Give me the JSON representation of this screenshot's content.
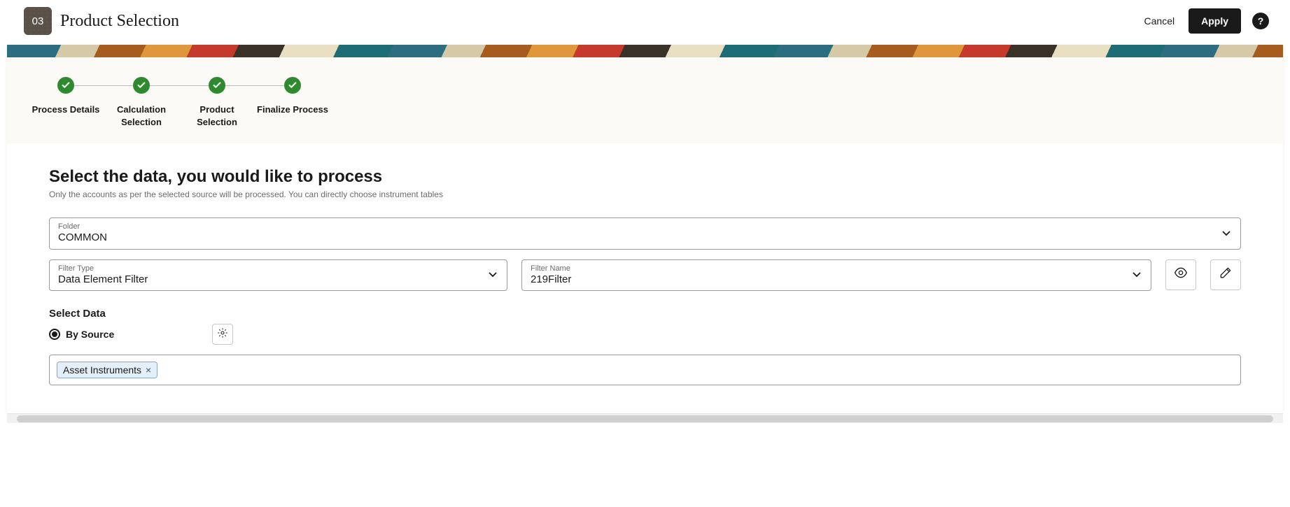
{
  "header": {
    "step_number": "03",
    "title": "Product Selection",
    "cancel": "Cancel",
    "apply": "Apply",
    "help": "?"
  },
  "stepper": {
    "steps": [
      {
        "label": "Process Details"
      },
      {
        "label": "Calculation\nSelection"
      },
      {
        "label": "Product\nSelection"
      },
      {
        "label": "Finalize Process"
      }
    ]
  },
  "content": {
    "title": "Select the data, you would like to process",
    "subtitle": "Only the accounts as per the selected source will be processed. You can directly choose instrument tables",
    "folder_label": "Folder",
    "folder_value": "COMMON",
    "filter_type_label": "Filter Type",
    "filter_type_value": "Data Element Filter",
    "filter_name_label": "Filter Name",
    "filter_name_value": "219Filter",
    "select_data_label": "Select Data",
    "radio_by_source": "By Source",
    "chips": [
      {
        "label": "Asset Instruments"
      }
    ]
  }
}
